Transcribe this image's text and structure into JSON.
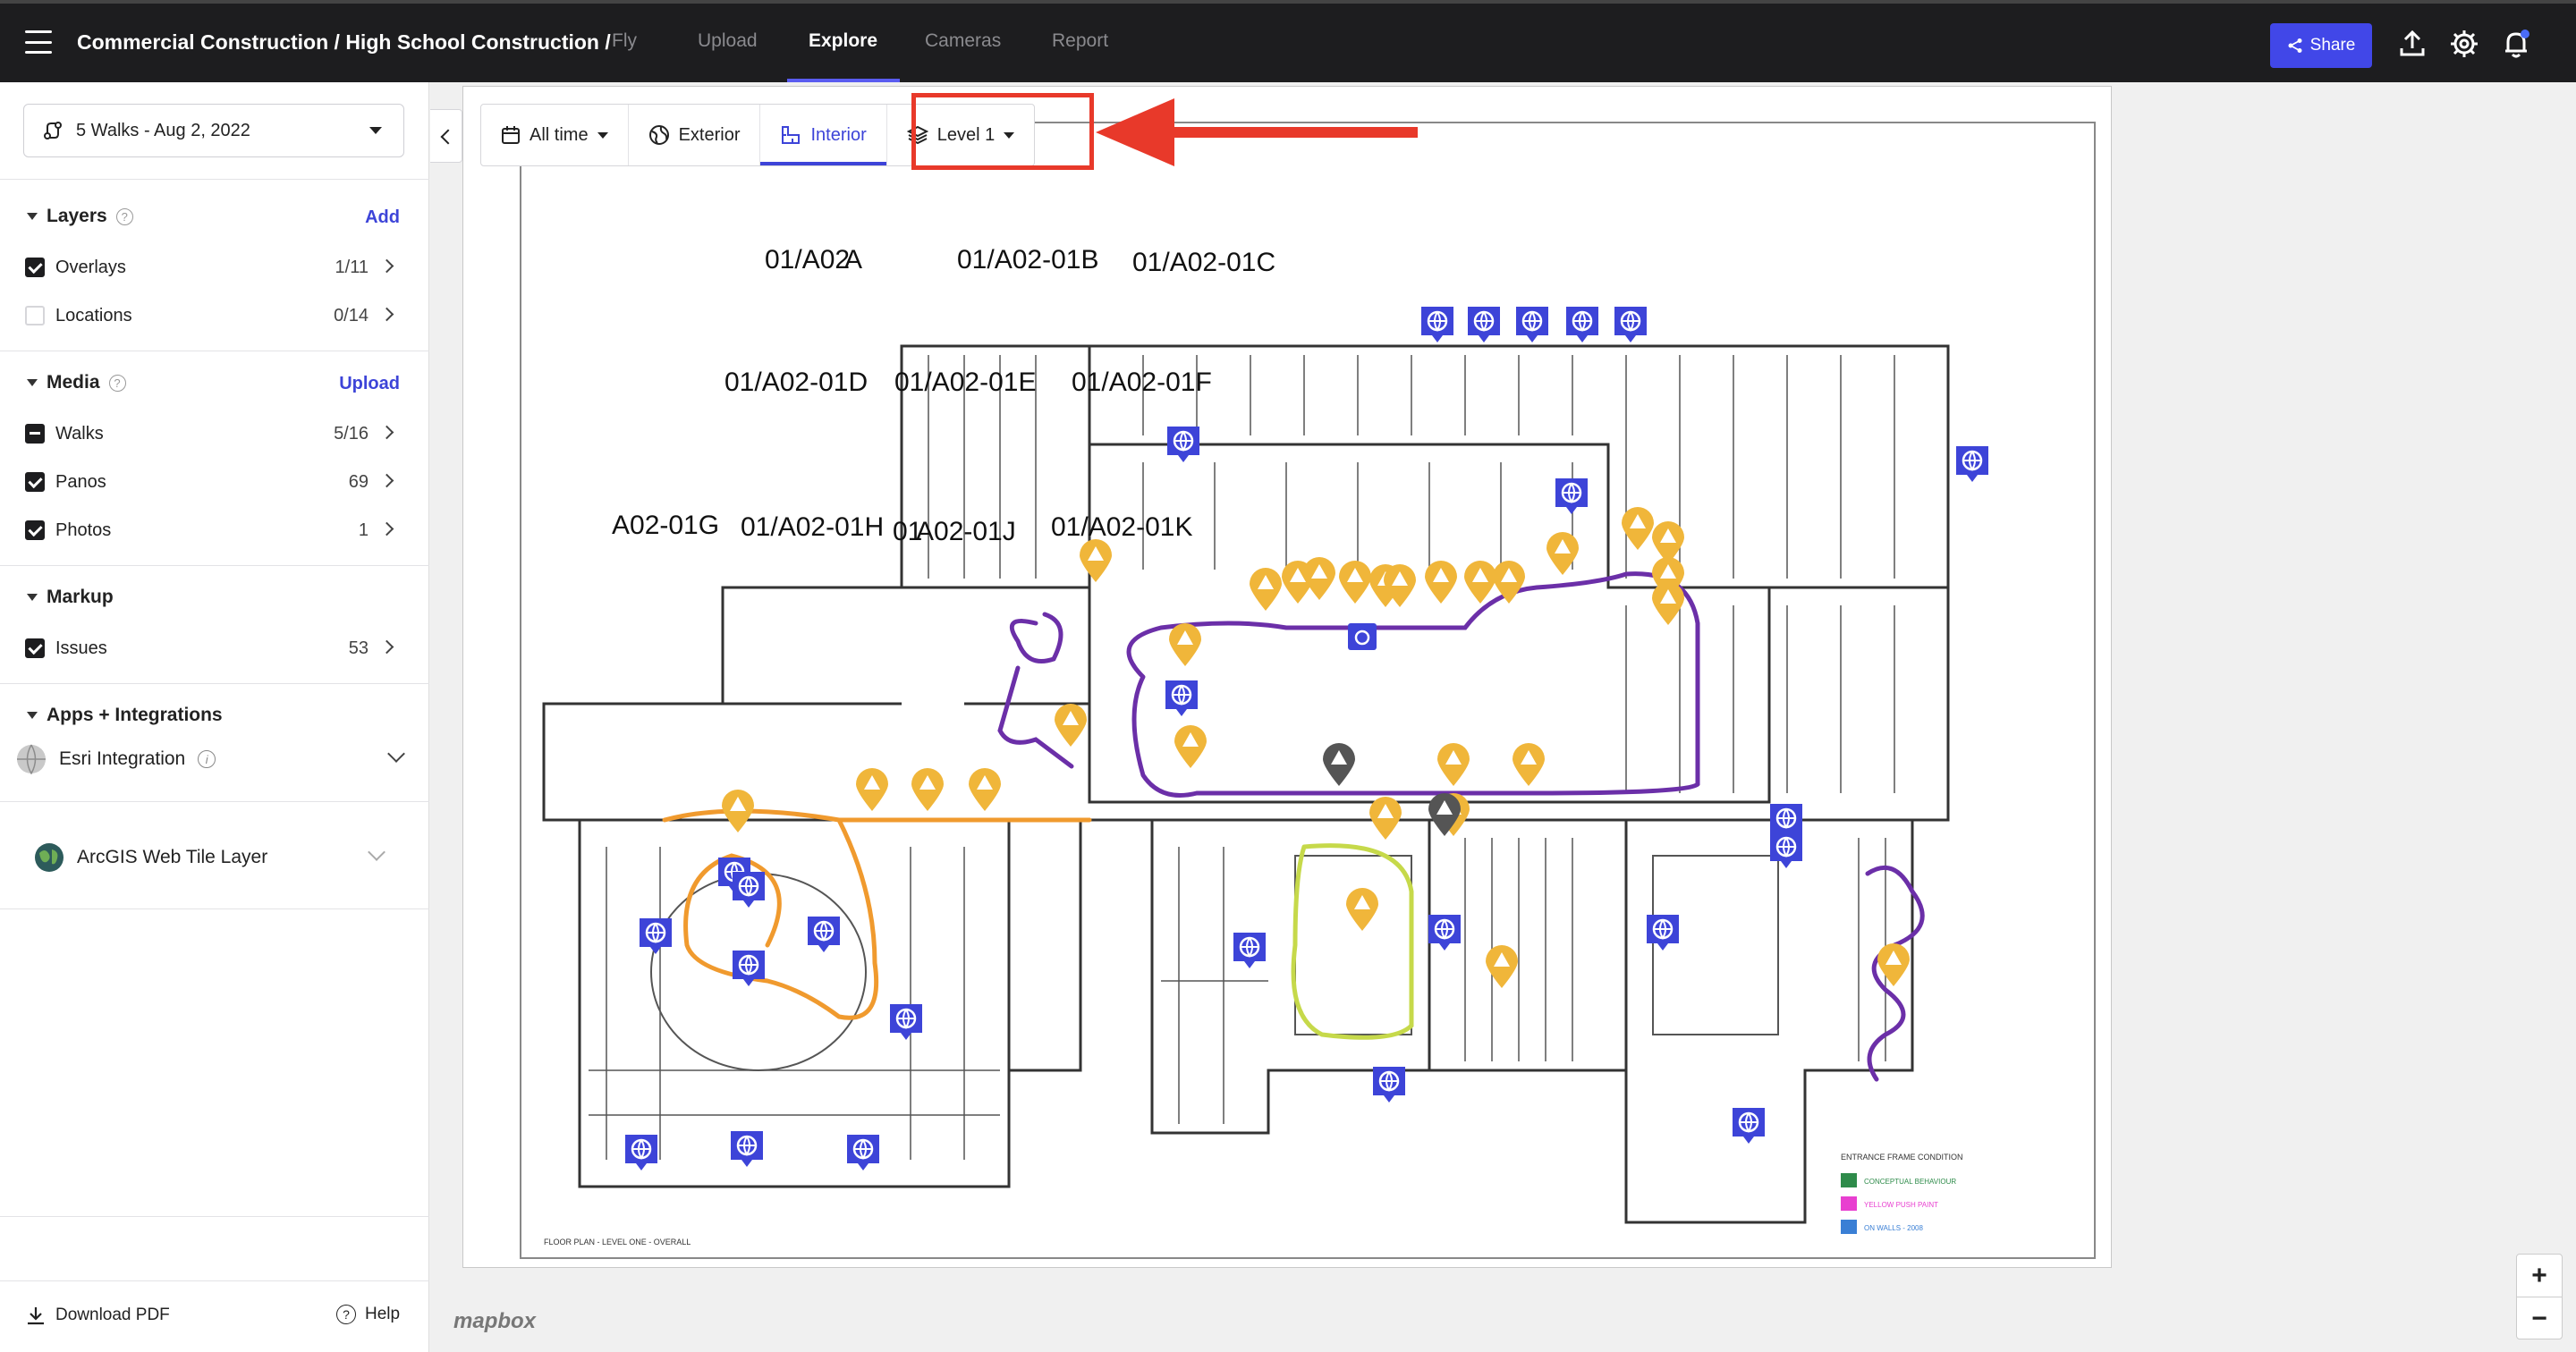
{
  "topbar": {
    "project_path": "Commercial Construction / High School Construction /",
    "tabs": [
      {
        "label": "Fly",
        "active": false
      },
      {
        "label": "Upload",
        "active": false
      },
      {
        "label": "Explore",
        "active": true
      },
      {
        "label": "Cameras",
        "active": false
      },
      {
        "label": "Report",
        "active": false
      }
    ],
    "share_label": "Share",
    "accent": "#4147e8"
  },
  "sidebar": {
    "walk_selector": "5 Walks - Aug 2, 2022",
    "layers": {
      "title": "Layers",
      "action": "Add",
      "items": [
        {
          "label": "Overlays",
          "count": "1/11",
          "state": "checked"
        },
        {
          "label": "Locations",
          "count": "0/14",
          "state": "empty"
        }
      ]
    },
    "media": {
      "title": "Media",
      "action": "Upload",
      "items": [
        {
          "label": "Walks",
          "count": "5/16",
          "state": "partial"
        },
        {
          "label": "Panos",
          "count": "69",
          "state": "checked"
        },
        {
          "label": "Photos",
          "count": "1",
          "state": "checked"
        }
      ]
    },
    "markup": {
      "title": "Markup",
      "items": [
        {
          "label": "Issues",
          "count": "53",
          "state": "checked"
        }
      ]
    },
    "apps": {
      "title": "Apps + Integrations",
      "esri": "Esri Integration",
      "arcgis": "ArcGIS Web Tile Layer"
    },
    "footer": {
      "download": "Download PDF",
      "help": "Help"
    }
  },
  "toolbar": {
    "time": "All time",
    "exterior": "Exterior",
    "interior": "Interior",
    "level": "Level 1"
  },
  "map": {
    "room_labels": [
      "01/A02",
      "A",
      "01/A02-01B",
      "01/A02-01C",
      "01/A02-01D",
      "01/A02-01E",
      "01/A02-01F",
      "A02-01G",
      "01/A02-01H",
      "01",
      "A02-01J",
      "01/A02-01K"
    ],
    "legend_title": "ENTRANCE FRAME CONDITION",
    "legend": [
      {
        "label": "CONCEPTUAL BEHAVIOUR",
        "color": "#2e8b4a"
      },
      {
        "label": "YELLOW PUSH PAINT",
        "color": "#e83fd0"
      },
      {
        "label": "ON WALLS - 2008",
        "color": "#3a7fd5"
      }
    ],
    "plan_caption": "FLOOR PLAN - LEVEL ONE - OVERALL",
    "attribution": "mapbox",
    "highlight_color": "#e8392a",
    "issue_color": "#f0b63a",
    "pano_color": "#3d44d8",
    "walk_colors": [
      "#6b2fa8",
      "#f09a2e",
      "#c6d94a"
    ]
  }
}
